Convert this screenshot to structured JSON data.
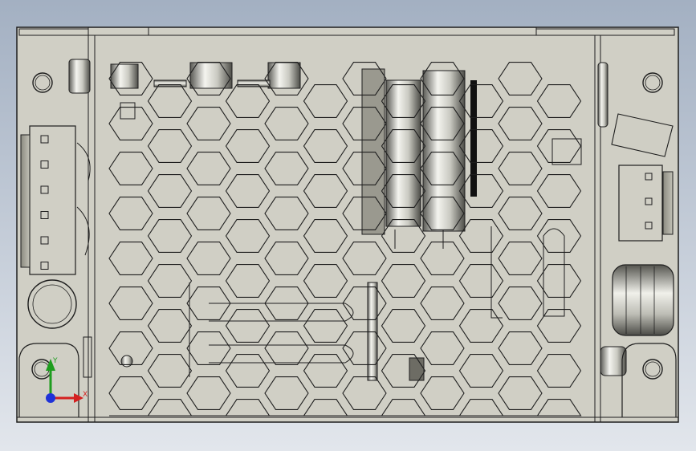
{
  "view": {
    "title": "",
    "background_top": "#a3b0c2",
    "background_bottom": "#e2e6ec"
  },
  "model": {
    "body_color": "#d0cfc5",
    "edge_color": "#1e1e1e",
    "cutout_color": "#f2f1ec"
  },
  "triad": {
    "x_label": "X",
    "y_label": "Y",
    "x_color": "#d42020",
    "y_color": "#1e9d1e",
    "z_color": "#1f32d8"
  }
}
